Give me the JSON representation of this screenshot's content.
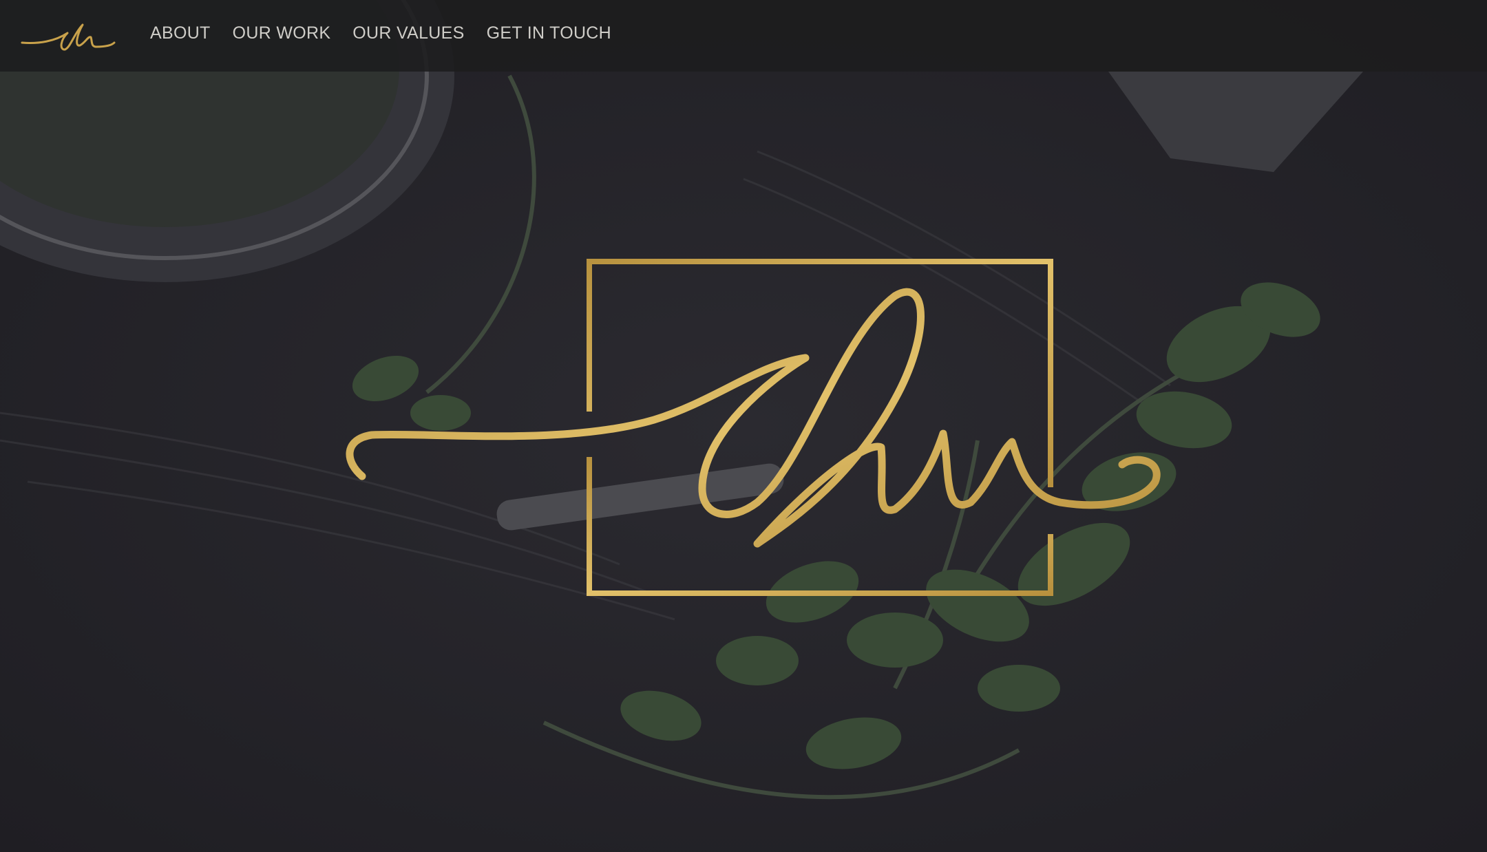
{
  "colors": {
    "gold": "#c9a24b",
    "nav_background": "#1c1c1e",
    "page_background": "#26252b",
    "nav_text": "#cfcdc8"
  },
  "brand": {
    "logo_icon": "signature-monogram-icon"
  },
  "nav": {
    "items": [
      {
        "label": "ABOUT"
      },
      {
        "label": "OUR WORK"
      },
      {
        "label": "OUR VALUES"
      },
      {
        "label": "GET IN TOUCH"
      }
    ]
  },
  "hero": {
    "logo_icon": "framed-signature-monogram-icon"
  }
}
